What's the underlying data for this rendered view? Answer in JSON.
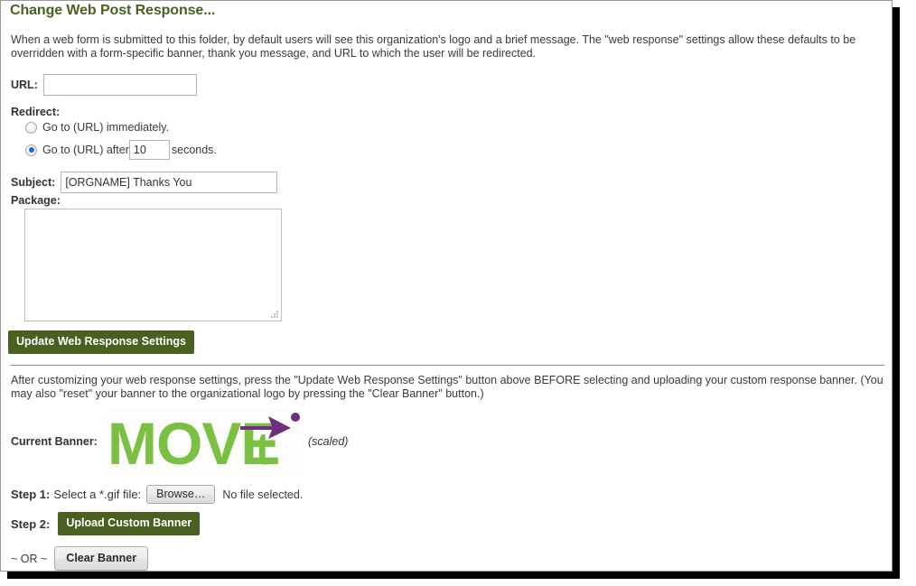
{
  "page": {
    "title": "Change Web Post Response...",
    "intro": "When a web form is submitted to this folder, by default users will see this organization's logo and a brief message. The \"web response\" settings allow these defaults to be overridden with a form-specific banner, thank you message, and URL to which the user will be redirected."
  },
  "form": {
    "url_label": "URL:",
    "url_value": "",
    "url_placeholder": "",
    "redirect_label": "Redirect:",
    "redirect_options": [
      {
        "label": "Go to (URL) immediately.",
        "selected": false
      },
      {
        "label_before": "Go to (URL) after",
        "label_after": "seconds.",
        "selected": true,
        "seconds_value": "10"
      }
    ],
    "subject_label": "Subject:",
    "subject_value": "[ORGNAME] Thanks You",
    "package_label": "Package:",
    "package_value": "",
    "update_button": "Update Web Response Settings"
  },
  "banner_section": {
    "note": "After customizing your web response settings, press the \"Update Web Response Settings\" button above BEFORE selecting and uploading your custom response banner. (You may also \"reset\" your banner to the organizational logo by pressing the \"Clear Banner\" button.)",
    "current_banner_label": "Current Banner:",
    "logo_text_primary": "MOVE",
    "logo_text_secondary": "it",
    "scaled_note": "(scaled)",
    "step1_name": "Step 1:",
    "step1_desc": "Select a *.gif file:",
    "browse_button": "Browse…",
    "file_status": "No file selected.",
    "step2_name": "Step 2:",
    "upload_button": "Upload Custom Banner",
    "or_text": "~ OR ~",
    "clear_button": "Clear Banner"
  },
  "colors": {
    "heading_green": "#4a6020",
    "button_green": "#4a6020",
    "logo_green": "#7ac143",
    "logo_purple": "#6d2f7f",
    "radio_blue": "#1a6fd4"
  }
}
